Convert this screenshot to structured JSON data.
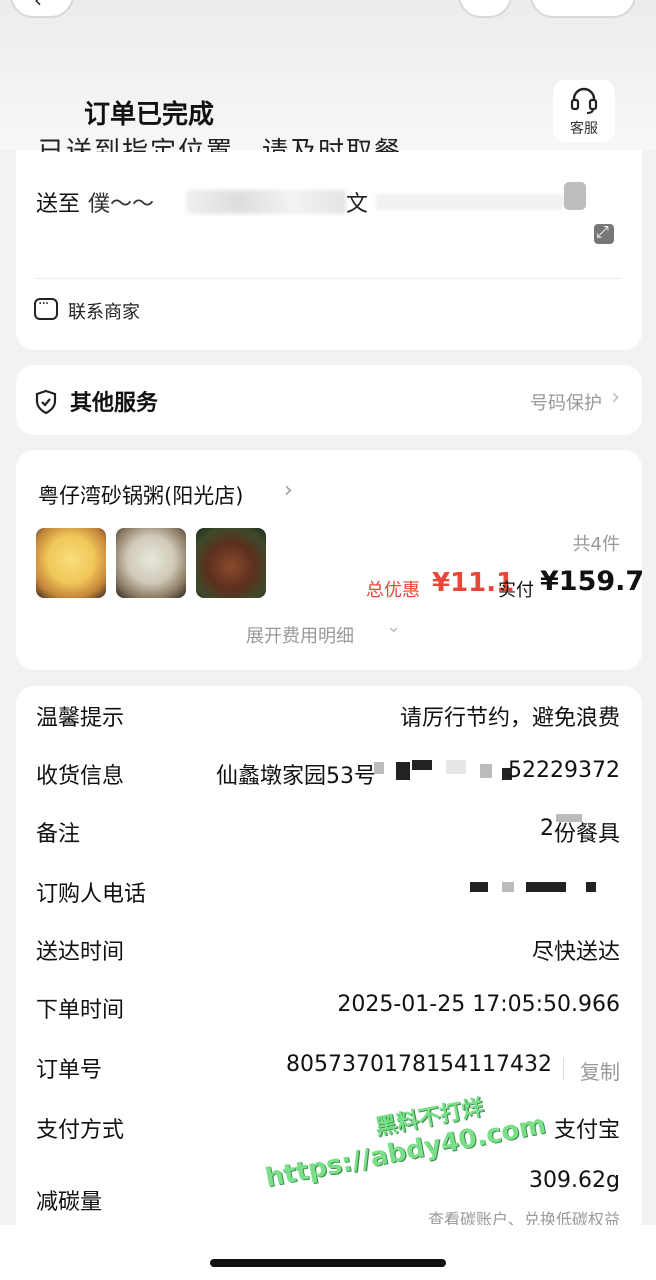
{
  "header": {
    "title": "订单已完成",
    "back_icon": "chevron-left-icon",
    "service_label": "客服",
    "service_icon": "headset-icon"
  },
  "delivery": {
    "top_text_cut": "已送到指定位置，请及时取餐",
    "deliver_to_label": "送至",
    "recipient_partial": "僕〜〜",
    "address_partial": "文",
    "contact_merchant": "联系商家"
  },
  "services": {
    "title": "其他服务",
    "right_label": "号码保护"
  },
  "store": {
    "name": "粤仔湾砂锅粥(阳光店)",
    "item_count": "共4件",
    "discount_label": "总优惠",
    "discount_value": "¥11.1",
    "paid_label": "实付",
    "paid_value": "¥159.7",
    "expand_fee": "展开费用明细",
    "thumbnails": [
      "food-thumbnail-1",
      "food-thumbnail-2",
      "food-thumbnail-3"
    ]
  },
  "info": {
    "tip_label": "温馨提示",
    "tip_value": "请厉行节约，避免浪费",
    "address_label": "收货信息",
    "address_value_start": "仙蠡墩家园53号",
    "address_value_end": "52229372",
    "note_label": "备注",
    "note_value": "份餐具",
    "note_prefix": "2",
    "phone_label": "订购人电话",
    "delivery_time_label": "送达时间",
    "delivery_time_value": "尽快送达",
    "order_time_label": "下单时间",
    "order_time_value": "2025-01-25 17:05:50.966",
    "order_no_label": "订单号",
    "order_no_value": "8057370178154117432",
    "copy_label": "复制",
    "payment_label": "支付方式",
    "payment_value": "支付宝",
    "carbon_label": "减碳量",
    "carbon_value": "309.62g",
    "carbon_link": "查看碳账户、兑换低碳权益"
  },
  "watermark": {
    "line1": "黑料不打烊",
    "line2": "https://abdy40.com"
  },
  "colors": {
    "accent_red": "#e8483a",
    "background": "#f2f2f2",
    "card": "#ffffff",
    "muted_text": "#999999",
    "watermark_green": "#79e089"
  }
}
